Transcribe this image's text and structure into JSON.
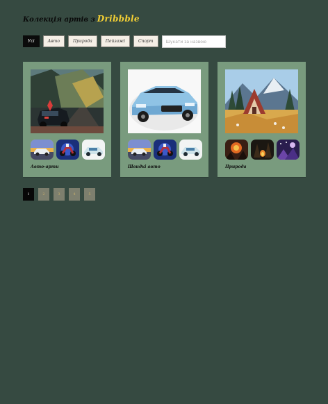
{
  "header": {
    "title": "Колекція артів з",
    "brand": "Dribbble"
  },
  "filters": {
    "buttons": [
      "Усі",
      "Авто",
      "Природа",
      "Пейзажі",
      "Спорт"
    ],
    "active_index": 0,
    "search_placeholder": "Шукати за назвою"
  },
  "cards": [
    {
      "caption": "Авто-арти",
      "thumbs": [
        "car-on-sunset-road",
        "motorcycle-night",
        "white-sports-car"
      ]
    },
    {
      "caption": "Швидкі авто",
      "thumbs": [
        "car-on-sunset-road",
        "motorcycle-night",
        "white-sports-car"
      ]
    },
    {
      "caption": "Природа",
      "thumbs": [
        "fire-landscape",
        "campfire-forest",
        "purple-night-sky"
      ]
    }
  ],
  "pagination": {
    "pages": [
      "1",
      "2",
      "3",
      "4",
      "5"
    ],
    "active_index": 0
  },
  "colors": {
    "background": "#364a41",
    "card": "#799b7e",
    "brand": "#f3cf34",
    "active_button": "#0b0b0b"
  }
}
